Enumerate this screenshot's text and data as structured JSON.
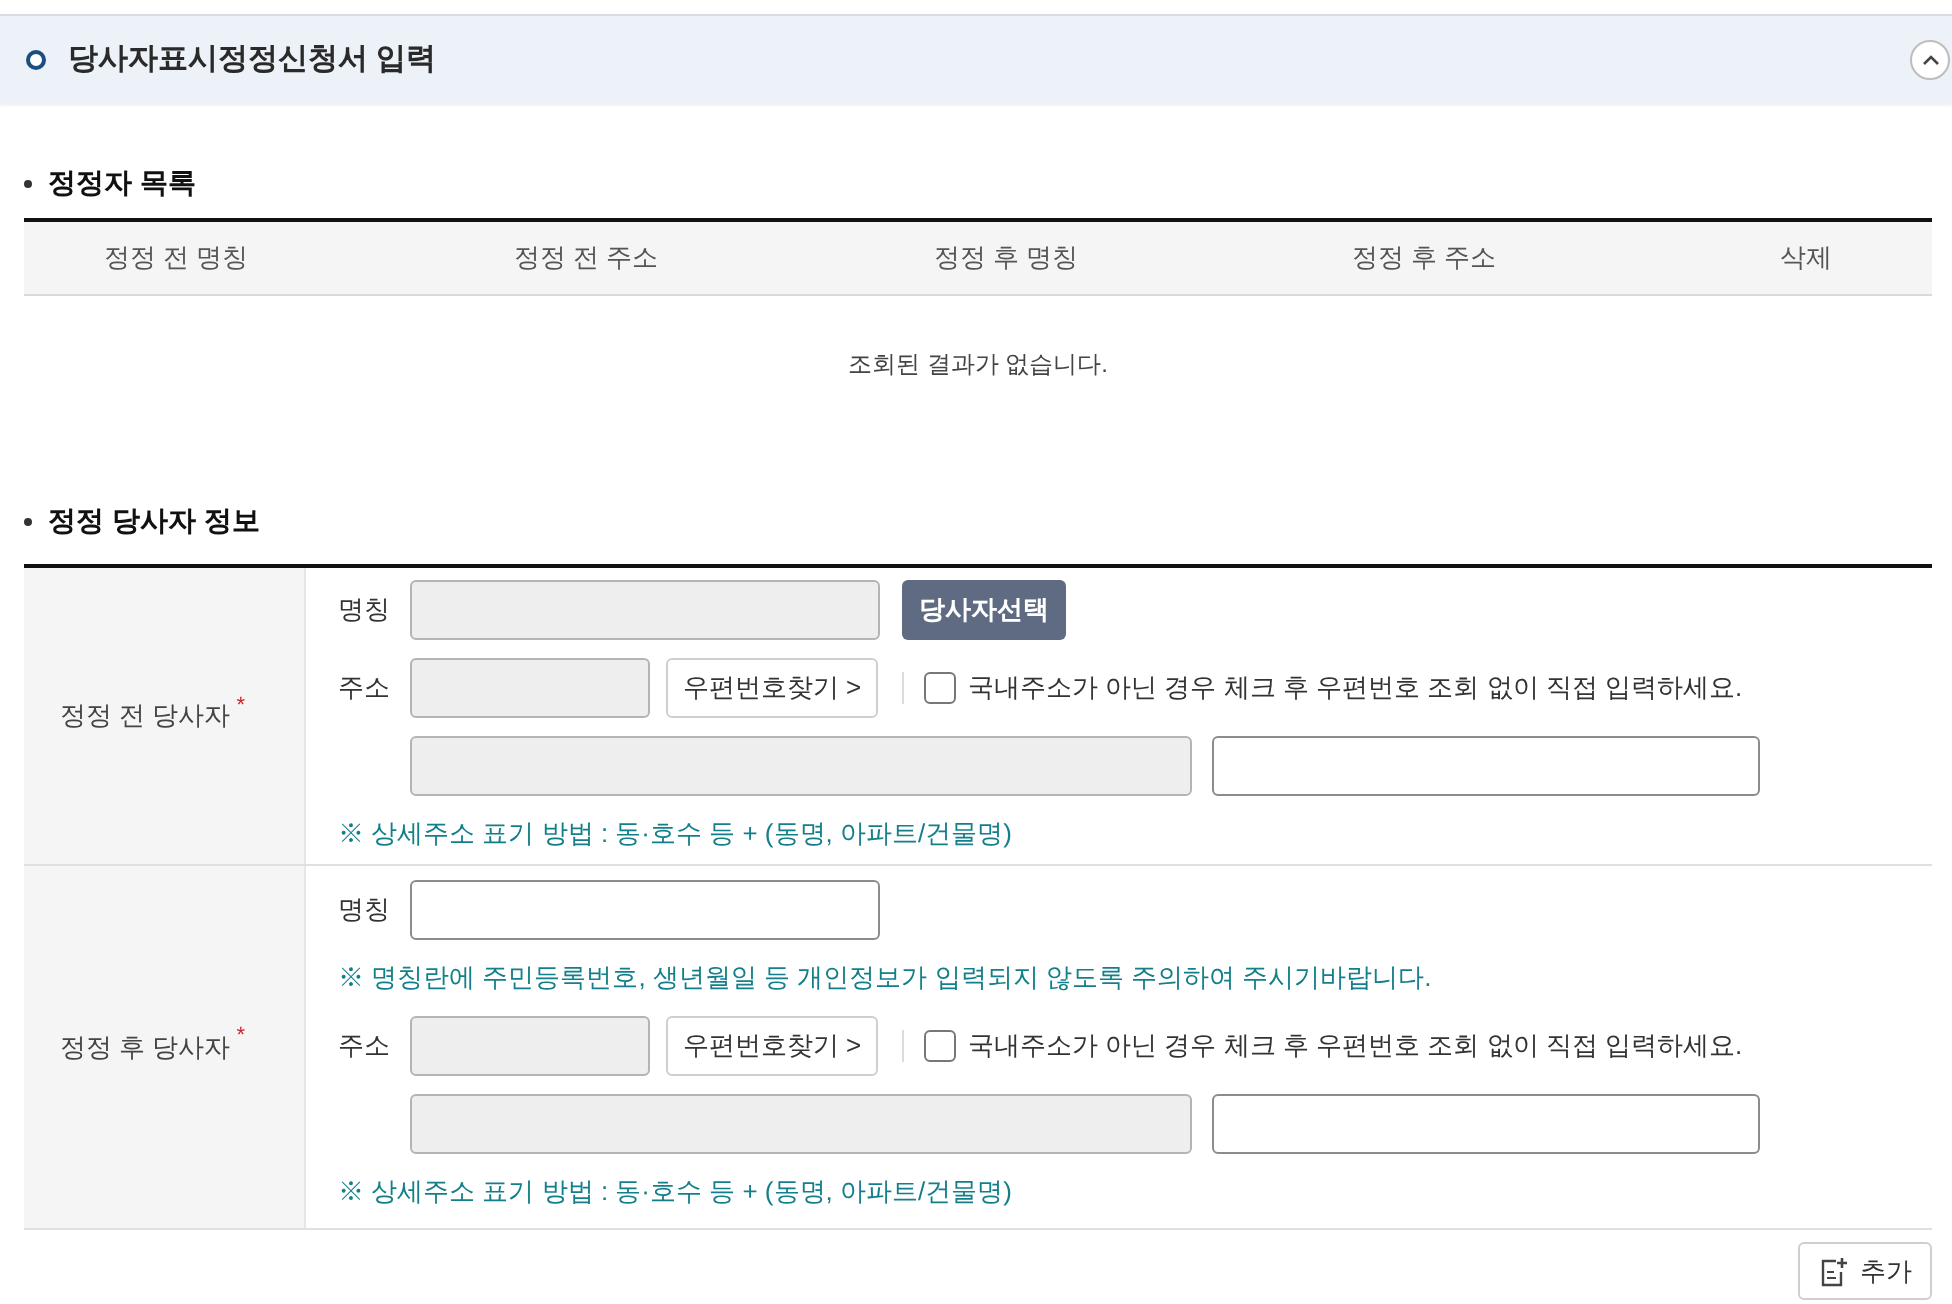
{
  "panel": {
    "title": "당사자표시정정신청서 입력",
    "expanded": true
  },
  "correction_list": {
    "heading": "정정자 목록",
    "columns": [
      "정정 전 명칭",
      "정정 전 주소",
      "정정 후 명칭",
      "정정 후 주소",
      "삭제"
    ],
    "empty_message": "조회된 결과가 없습니다."
  },
  "party_info": {
    "heading": "정정 당사자 정보",
    "sections": [
      {
        "label": "정정 전 당사자",
        "required_mark": "*",
        "rows": [
          {
            "kind": "name",
            "label": "명칭",
            "readonly": true,
            "button": "당사자선택"
          },
          {
            "kind": "address",
            "label": "주소",
            "postcode_readonly": true,
            "search_button": "우편번호찾기 >",
            "foreign_checkbox": {
              "label": "국내주소가 아닌 경우 체크 후 우편번호 조회 없이 직접 입력하세요.",
              "checked": false
            }
          },
          {
            "kind": "address_detail",
            "fields": [
              {
                "readonly": true
              },
              {
                "readonly": false
              }
            ]
          },
          {
            "kind": "note",
            "text": "※ 상세주소 표기 방법 : 동·호수 등 + (동명, 아파트/건물명)"
          }
        ]
      },
      {
        "label": "정정 후 당사자",
        "required_mark": "*",
        "rows": [
          {
            "kind": "name",
            "label": "명칭",
            "readonly": false
          },
          {
            "kind": "note",
            "text": "※ 명칭란에 주민등록번호, 생년월일 등 개인정보가 입력되지 않도록 주의하여 주시기바랍니다."
          },
          {
            "kind": "address",
            "label": "주소",
            "postcode_readonly": true,
            "search_button": "우편번호찾기 >",
            "foreign_checkbox": {
              "label": "국내주소가 아닌 경우 체크 후 우편번호 조회 없이 직접 입력하세요.",
              "checked": false
            }
          },
          {
            "kind": "address_detail",
            "fields": [
              {
                "readonly": true
              },
              {
                "readonly": false
              }
            ]
          },
          {
            "kind": "note",
            "text": "※ 상세주소 표기 방법 : 동·호수 등 + (동명, 아파트/건물명)"
          }
        ]
      }
    ]
  },
  "add_button": "추가"
}
